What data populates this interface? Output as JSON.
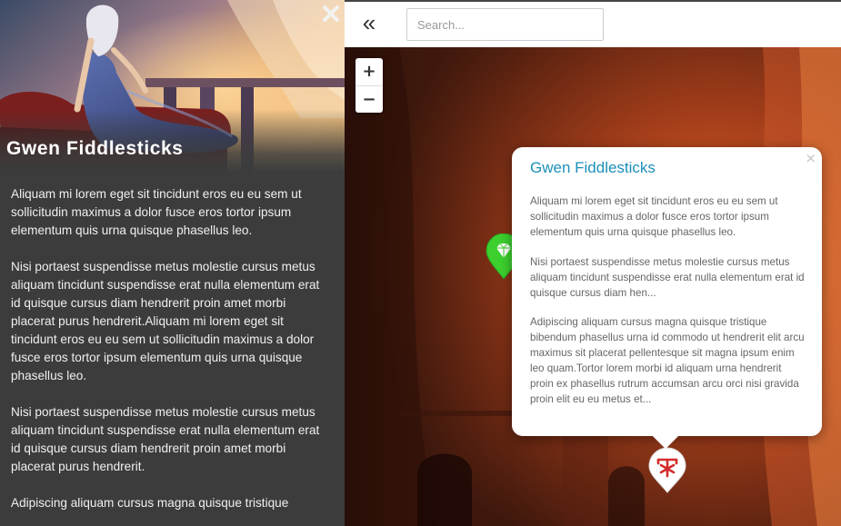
{
  "sidebar": {
    "close_label": "✕",
    "title": "Gwen Fiddlesticks",
    "paragraphs": [
      "Aliquam mi lorem eget sit tincidunt eros eu eu sem ut sollicitudin maximus a dolor fusce eros tortor ipsum elementum quis urna quisque phasellus leo.",
      "Nisi portaest suspendisse metus molestie cursus metus aliquam tincidunt suspendisse erat nulla elementum erat id quisque cursus diam hendrerit proin amet morbi placerat purus hendrerit.Aliquam mi lorem eget sit tincidunt eros eu eu sem ut sollicitudin maximus a dolor fusce eros tortor ipsum elementum quis urna quisque phasellus leo.",
      "Nisi portaest suspendisse metus molestie cursus metus aliquam tincidunt suspendisse erat nulla elementum erat id quisque cursus diam hendrerit proin amet morbi placerat purus hendrerit.",
      "Adipiscing aliquam cursus magna quisque tristique"
    ]
  },
  "topbar": {
    "collapse_label": "«",
    "search_placeholder": "Search..."
  },
  "map": {
    "zoom_in": "+",
    "zoom_out": "−",
    "markers": [
      {
        "icon": "gem-icon",
        "color": "#3ccf2e"
      },
      {
        "icon": "alchemy-symbol-icon",
        "color": "#d42b2b"
      }
    ]
  },
  "popup": {
    "close_label": "×",
    "title": "Gwen Fiddlesticks",
    "paragraphs": [
      "Aliquam mi lorem eget sit tincidunt eros eu eu sem ut sollicitudin maximus a dolor fusce eros tortor ipsum elementum quis urna quisque phasellus leo.",
      "Nisi portaest suspendisse metus molestie cursus metus aliquam tincidunt suspendisse erat nulla elementum erat id quisque cursus diam hen...",
      "Adipiscing aliquam cursus magna quisque tristique bibendum phasellus urna id commodo ut hendrerit elit arcu maximus sit placerat pellentesque sit magna ipsum enim leo quam.Tortor lorem morbi id aliquam urna hendrerit proin ex phasellus rutrum accumsan arcu orci nisi gravida proin elit eu eu metus et..."
    ]
  }
}
